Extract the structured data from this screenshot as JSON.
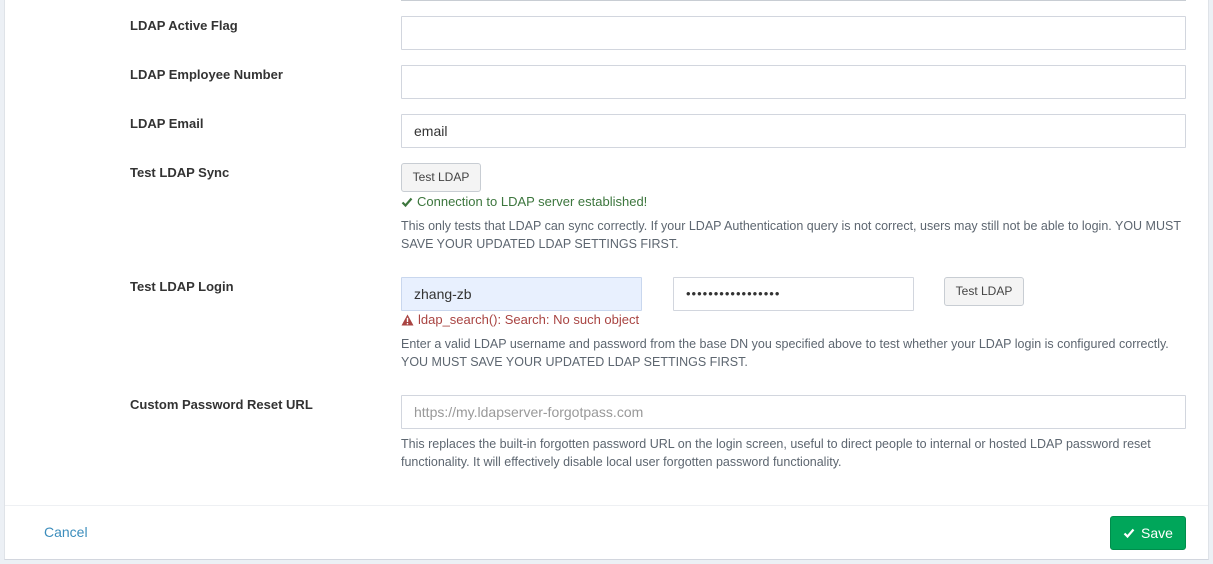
{
  "fields": {
    "ldap_active_flag": {
      "label": "LDAP Active Flag",
      "value": ""
    },
    "ldap_employee_number": {
      "label": "LDAP Employee Number",
      "value": ""
    },
    "ldap_email": {
      "label": "LDAP Email",
      "value": "email"
    }
  },
  "test_sync": {
    "label": "Test LDAP Sync",
    "button": "Test LDAP",
    "status": "Connection to LDAP server established!",
    "help": "This only tests that LDAP can sync correctly. If your LDAP Authentication query is not correct, users may still not be able to login. YOU MUST SAVE YOUR UPDATED LDAP SETTINGS FIRST."
  },
  "test_login": {
    "label": "Test LDAP Login",
    "username": "zhang-zb",
    "password": "•••••••••••••••••",
    "button": "Test LDAP",
    "error": "ldap_search(): Search: No such object",
    "help": "Enter a valid LDAP username and password from the base DN you specified above to test whether your LDAP login is configured correctly. YOU MUST SAVE YOUR UPDATED LDAP SETTINGS FIRST."
  },
  "password_reset": {
    "label": "Custom Password Reset URL",
    "placeholder": "https://my.ldapserver-forgotpass.com",
    "help": "This replaces the built-in forgotten password URL on the login screen, useful to direct people to internal or hosted LDAP password reset functionality. It will effectively disable local user forgotten password functionality."
  },
  "footer": {
    "cancel": "Cancel",
    "save": "Save"
  },
  "colors": {
    "success": "#3c763d",
    "error": "#a94442",
    "save_bg": "#00a65a",
    "link": "#3c8dbc"
  },
  "icons": {
    "success": "check-icon",
    "error": "warning-triangle-icon",
    "save": "check-icon"
  }
}
